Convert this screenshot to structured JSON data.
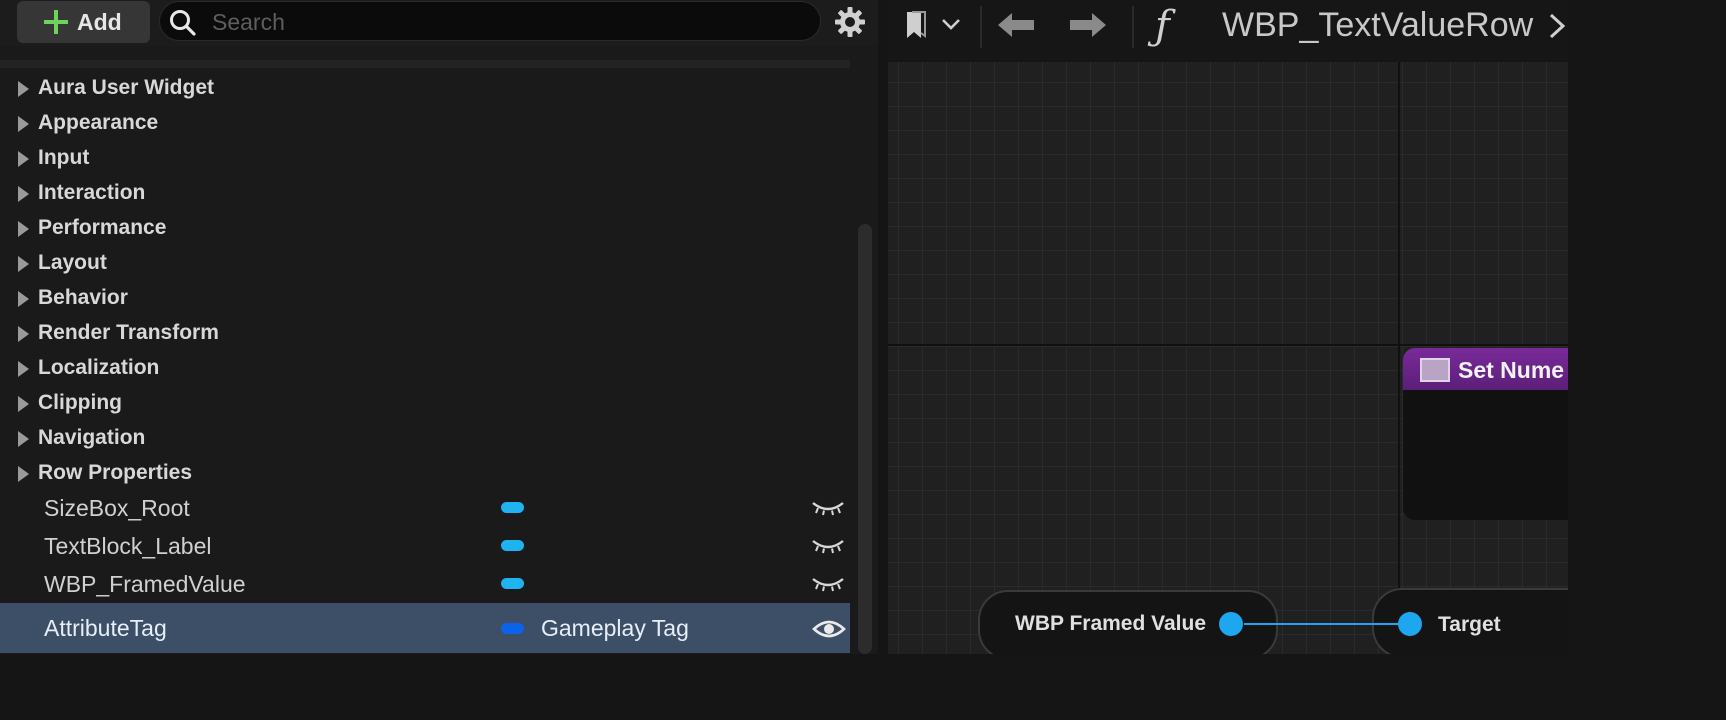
{
  "toolbar": {
    "add_label": "Add",
    "search_placeholder": "Search"
  },
  "categories": [
    "Aura User Widget",
    "Appearance",
    "Input",
    "Interaction",
    "Performance",
    "Layout",
    "Behavior",
    "Render Transform",
    "Localization",
    "Clipping",
    "Navigation",
    "Row Properties"
  ],
  "variables": [
    {
      "name": "SizeBox_Root",
      "type": ""
    },
    {
      "name": "TextBlock_Label",
      "type": ""
    },
    {
      "name": "WBP_FramedValue",
      "type": ""
    },
    {
      "name": "AttributeTag",
      "type": "Gameplay Tag",
      "selected": true
    }
  ],
  "graph": {
    "title": "WBP_TextValueRow",
    "function_symbol": "ƒ",
    "set_node_title": "Set Nume",
    "var_node_label": "WBP Framed Value",
    "target_pin_label": "Target"
  },
  "colors": {
    "accent_pin": "#1ea6ee",
    "selected_row": "#3d4f66",
    "function_header": "#7a2a9a",
    "add_plus": "#6fd25a"
  }
}
